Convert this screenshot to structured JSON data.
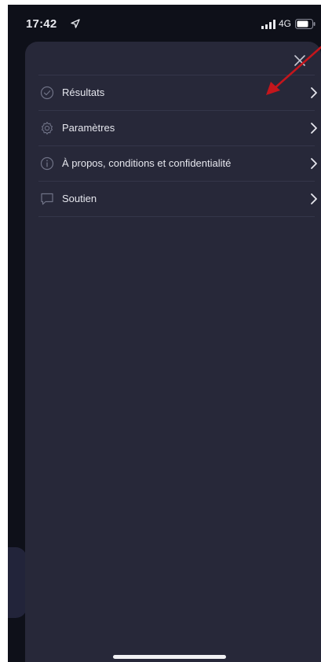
{
  "status_bar": {
    "time": "17:42",
    "network": "4G",
    "icons": [
      "location-arrow-icon",
      "signal-bars-icon",
      "battery-icon"
    ]
  },
  "sheet": {
    "close_icon": "close-icon",
    "menu": [
      {
        "label": "Résultats",
        "icon": "check-circle-icon"
      },
      {
        "label": "Paramètres",
        "icon": "gear-icon"
      },
      {
        "label": "À propos, conditions et confidentialité",
        "icon": "info-circle-icon"
      },
      {
        "label": "Soutien",
        "icon": "speech-bubble-icon"
      }
    ]
  },
  "colors": {
    "background": "#0e1019",
    "sheet": "#272839",
    "divider": "#34364a",
    "text": "#e6e7ee",
    "icon_muted": "#6f7286",
    "annotation_arrow": "#c4161c"
  }
}
